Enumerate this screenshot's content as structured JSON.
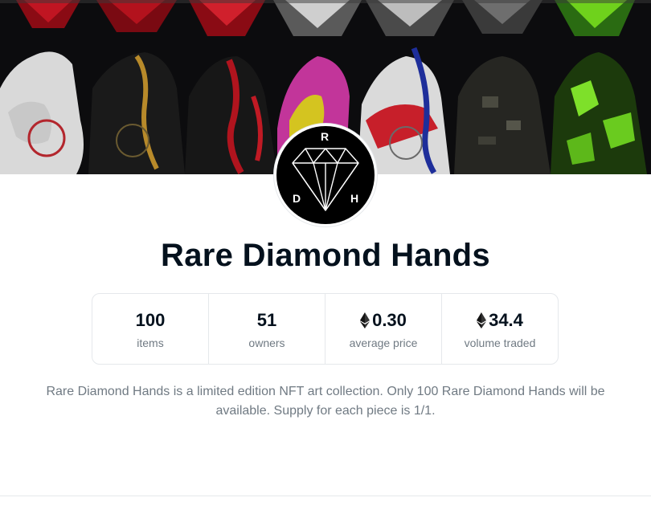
{
  "collection": {
    "name": "Rare Diamond Hands",
    "logo_letters": {
      "top": "R",
      "left": "D",
      "right": "H"
    },
    "description": "Rare Diamond Hands is a limited edition NFT art collection. Only 100 Rare Diamond Hands will be available. Supply for each piece is 1/1."
  },
  "stats": [
    {
      "value": "100",
      "label": "items",
      "icon": null
    },
    {
      "value": "51",
      "label": "owners",
      "icon": null
    },
    {
      "value": "0.30",
      "label": "average price",
      "icon": "ethereum-icon"
    },
    {
      "value": "34.4",
      "label": "volume traded",
      "icon": "ethereum-icon"
    }
  ],
  "colors": {
    "title": "#04111d",
    "muted_text": "#707a83",
    "border": "#e5e8eb",
    "banner_bg": "#0c0c0e"
  }
}
